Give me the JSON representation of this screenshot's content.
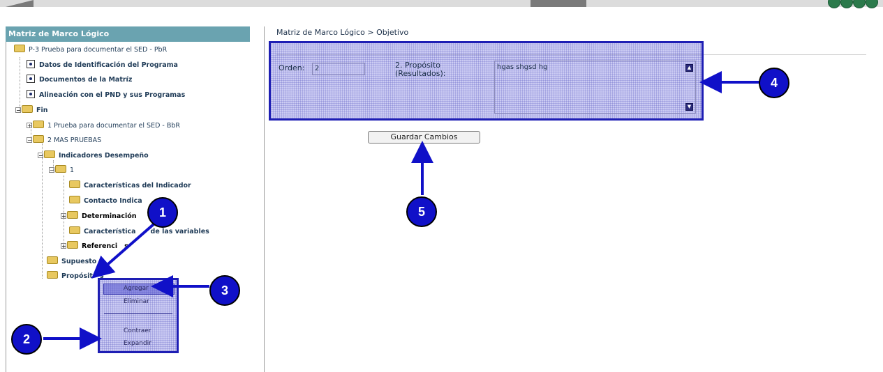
{
  "breadcrumb": "Matriz de Marco Lógico > Objetivo",
  "left_panel": {
    "title": "Matriz de Marco Lógico",
    "tree": {
      "root": "P-3 Prueba para documentar el SED - PbR",
      "datos": "Datos de Identificación del Programa",
      "documentos": "Documentos de la Matríz",
      "alineacion": "Alineación con el PND y sus Programas",
      "fin": "Fin",
      "item1": "1 Prueba para documentar el SED - BbR",
      "item2": "2 MAS PRUEBAS",
      "indicadores": "Indicadores Desempeño",
      "indicador_num": "1",
      "caracteristicas_indicador": "Características del Indicador",
      "contacto": "Contacto Indica",
      "determinacion": "Determinación",
      "caracteristicas_variables_a": "Característica",
      "caracteristicas_variables_b": "de las variables",
      "referencias_a": "Referenci",
      "referencias_b": "s",
      "supuestos": "Supuesto",
      "propositos_a": "Propósit",
      "propositos_b": "s"
    }
  },
  "context_menu": {
    "items": [
      "Agregar",
      "Eliminar",
      "Contraer",
      "Expandir"
    ]
  },
  "form": {
    "orden_label": "Orden:",
    "orden_value": "2",
    "proposito_label_1": "2. Propósito",
    "proposito_label_2": "(Resultados):",
    "proposito_value": "hgas shgsd hg",
    "save_button": "Guardar Cambios"
  },
  "callouts": [
    "1",
    "2",
    "3",
    "4",
    "5"
  ],
  "colors": {
    "accent_blue": "#1010c8",
    "panel_header": "#6aa3b0",
    "highlight": "#1e1eb4"
  }
}
